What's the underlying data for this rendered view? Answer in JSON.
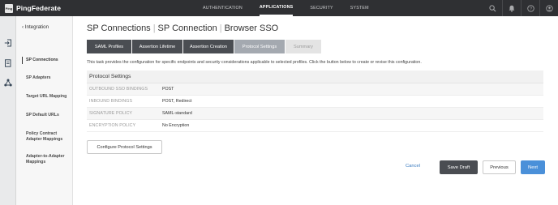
{
  "app": {
    "logo_mark": "Ping",
    "name": "PingFederate"
  },
  "nav": {
    "items": [
      "AUTHENTICATION",
      "APPLICATIONS",
      "SECURITY",
      "SYSTEM"
    ],
    "active": "APPLICATIONS"
  },
  "top_icons": [
    "search-icon",
    "bell-icon",
    "help-icon",
    "user-icon"
  ],
  "rail_icons": [
    "login-icon",
    "file-icon",
    "network-icon"
  ],
  "sidebar": {
    "back_label": "Integration",
    "items": [
      "SP Connections",
      "SP Adapters",
      "Target URL Mapping",
      "SP Default URLs",
      "Policy Contract Adapter Mappings",
      "Adapter-to-Adapter Mappings"
    ],
    "active": "SP Connections"
  },
  "breadcrumb": {
    "part1": "SP Connections",
    "part2": "SP Connection",
    "part3": "Browser SSO"
  },
  "tabs": [
    "SAML Profiles",
    "Assertion Lifetime",
    "Assertion Creation",
    "Protocol Settings",
    "Summary"
  ],
  "active_tab": "Protocol Settings",
  "description": "This task provides the configuration for specific endpoints and security considerations applicable to selected profiles. Click the button below to create or revise this configuration.",
  "table": {
    "title": "Protocol Settings",
    "rows": [
      {
        "label": "OUTBOUND SSO BINDINGS",
        "value": "POST"
      },
      {
        "label": "INBOUND BINDINGS",
        "value": "POST, Redirect"
      },
      {
        "label": "SIGNATURE POLICY",
        "value": "SAML-standard"
      },
      {
        "label": "ENCRYPTION POLICY",
        "value": "No Encryption"
      }
    ]
  },
  "configure_button": "Configure Protocol Settings",
  "actions": {
    "cancel": "Cancel",
    "save_draft": "Save Draft",
    "previous": "Previous",
    "next": "Next"
  },
  "colors": {
    "topbar": "#2f3033",
    "tab_dark": "#4a4d52",
    "tab_active": "#a4a9b0",
    "primary": "#4a90d9",
    "link": "#3a7bbf"
  }
}
